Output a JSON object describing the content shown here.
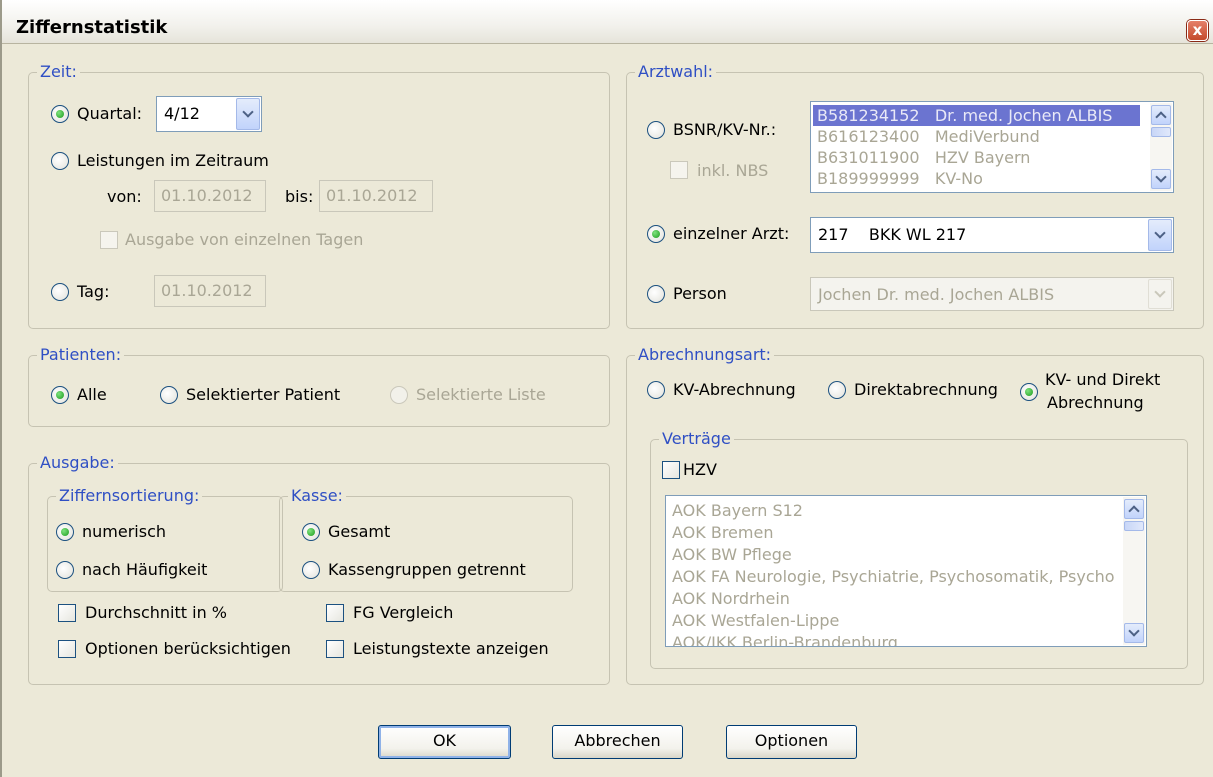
{
  "window": {
    "title": "Ziffernstatistik",
    "close_symbol": "x"
  },
  "zeit": {
    "label": "Zeit:",
    "quartal_label": "Quartal:",
    "quartal_value": "4/12",
    "leistungen_label": "Leistungen im Zeitraum",
    "von_label": "von:",
    "von_value": "01.10.2012",
    "bis_label": "bis:",
    "bis_value": "01.10.2012",
    "einzelne_tage_label": "Ausgabe von einzelnen Tagen",
    "tag_label": "Tag:",
    "tag_value": "01.10.2012",
    "selected": "quartal"
  },
  "patienten": {
    "label": "Patienten:",
    "alle_label": "Alle",
    "selektierter_patient_label": "Selektierter Patient",
    "selektierte_liste_label": "Selektierte Liste",
    "selected": "alle"
  },
  "ausgabe": {
    "label": "Ausgabe:",
    "sortierung_label": "Ziffernsortierung:",
    "numerisch_label": "numerisch",
    "haeufigkeit_label": "nach Häufigkeit",
    "kasse_label": "Kasse:",
    "gesamt_label": "Gesamt",
    "kassengruppen_label": "Kassengruppen getrennt",
    "durchschnitt_label": "Durchschnitt in %",
    "fg_vergleich_label": "FG Vergleich",
    "optionen_label": "Optionen berücksichtigen",
    "leistungstexte_label": "Leistungstexte anzeigen"
  },
  "arztwahl": {
    "label": "Arztwahl:",
    "bsnr_label": "BSNR/KV-Nr.:",
    "inkl_nbs_label": "inkl. NBS",
    "bsnr_list": [
      {
        "code": "B581234152",
        "name": "Dr. med. Jochen ALBIS"
      },
      {
        "code": "B616123400",
        "name": "MediVerbund"
      },
      {
        "code": "B631011900",
        "name": "HZV Bayern"
      },
      {
        "code": "B189999999",
        "name": "KV-No"
      }
    ],
    "einzelner_arzt_label": "einzelner Arzt:",
    "einzelner_arzt_value": "217    BKK WL 217",
    "person_label": "Person",
    "person_value": "Jochen Dr. med. Jochen ALBIS",
    "selected": "einzelner_arzt"
  },
  "abrechnungsart": {
    "label": "Abrechnungsart:",
    "kv_label": "KV-Abrechnung",
    "direkt_label": "Direktabrechnung",
    "kv_direkt_line1": "KV- und Direkt",
    "kv_direkt_line2": "Abrechnung",
    "selected": "kv_direkt"
  },
  "vertraege": {
    "label": "Verträge",
    "hzv_label": "HZV",
    "items": [
      "AOK Bayern S12",
      "AOK Bremen",
      "AOK BW Pflege",
      "AOK FA Neurologie, Psychiatrie, Psychosomatik, Psycho",
      "AOK Nordrhein",
      "AOK Westfalen-Lippe",
      "AOK/IKK Berlin-Brandenburg"
    ]
  },
  "buttons": {
    "ok": "OK",
    "abbrechen": "Abbrechen",
    "optionen": "Optionen"
  },
  "colors": {
    "group_label": "#2f4fc4",
    "background": "#ece9d8",
    "selection": "#6b74d0"
  }
}
